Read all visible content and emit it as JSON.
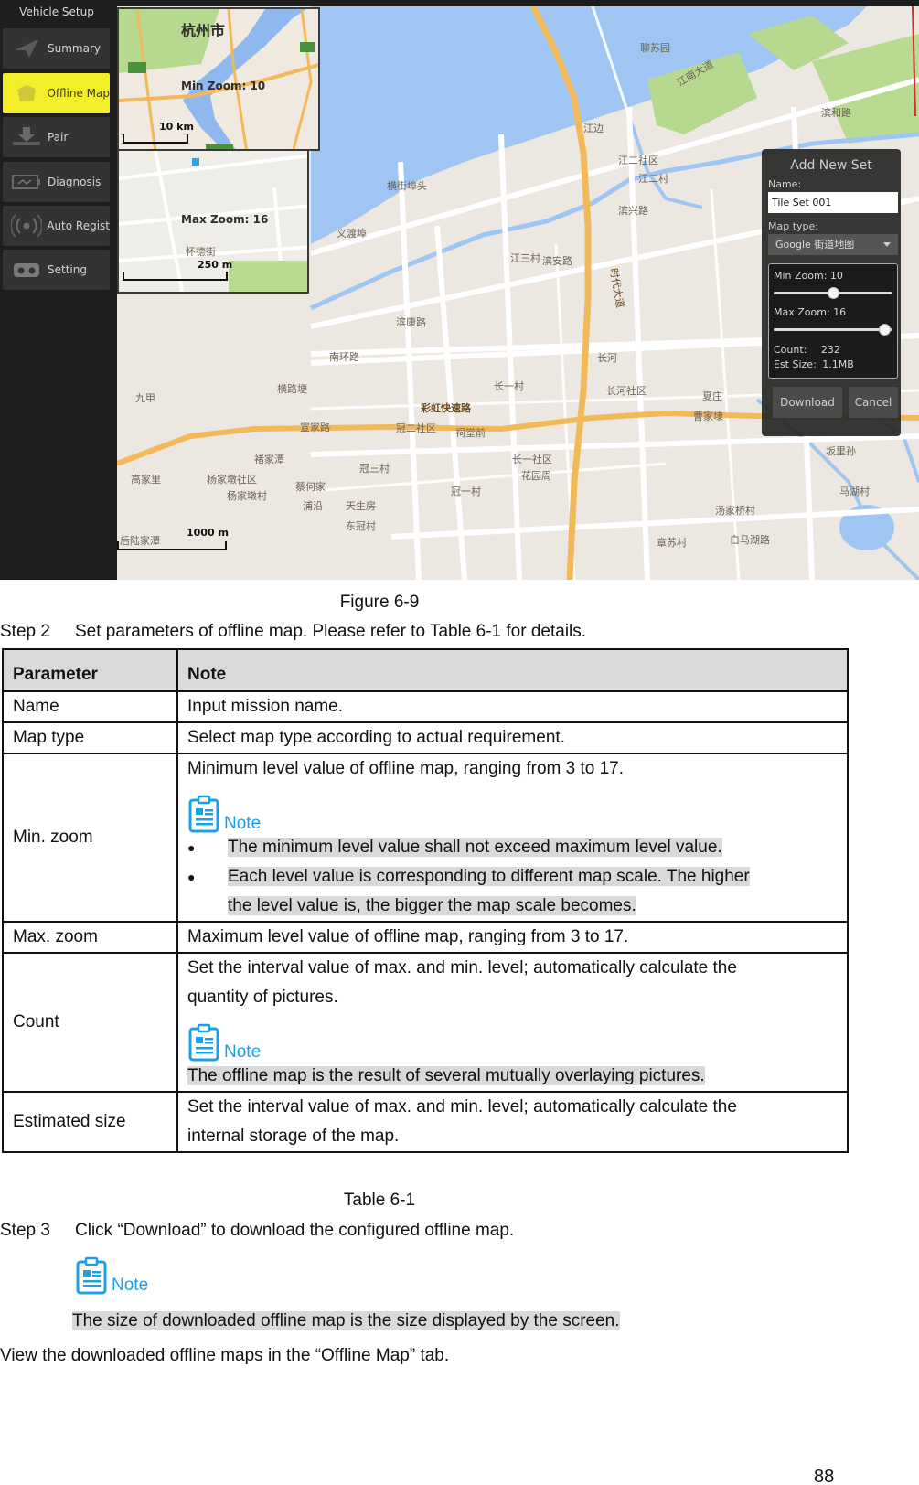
{
  "figure": {
    "sidebar": {
      "title": "Vehicle Setup",
      "items": [
        {
          "label": "Summary",
          "icon": "paper-plane-icon",
          "active": false
        },
        {
          "label": "Offline Map",
          "icon": "map-icon",
          "active": true
        },
        {
          "label": "Pair",
          "icon": "download-tray-icon",
          "active": false
        },
        {
          "label": "Diagnosis",
          "icon": "battery-pulse-icon",
          "active": false
        },
        {
          "label": "Auto Regist",
          "icon": "broadcast-icon",
          "active": false
        },
        {
          "label": "Setting",
          "icon": "controller-icon",
          "active": false
        }
      ]
    },
    "map": {
      "inset_min": {
        "label": "Min Zoom: 10",
        "scale": "10 km",
        "city": "杭州市"
      },
      "inset_max": {
        "label": "Max Zoom: 16",
        "scale": "250 m",
        "street": "怀德街"
      },
      "scale": "1000 m",
      "labels": [
        "江边",
        "江二社区",
        "江二村",
        "滨兴路",
        "江三村",
        "滨安路",
        "滨康路",
        "南环路",
        "长河",
        "长一村",
        "彩虹快速路",
        "冠二社区",
        "冠三村",
        "冠一村",
        "长一社区",
        "花园周",
        "杨家墩社区",
        "杨家墩村",
        "高家里",
        "蔡何家",
        "浦沿",
        "天生房",
        "东冠村",
        "长河社区",
        "夏庄",
        "曹家埭",
        "坂里孙",
        "马湖村",
        "汤家桥村",
        "章苏村",
        "白马湖路",
        "横街埠头",
        "义渡埠",
        "聊苏园",
        "时代大道",
        "江南大道",
        "滨和路",
        "九甲",
        "褚家潭",
        "祠堂前",
        "宣家路",
        "横路埂",
        "后陆家潭"
      ]
    },
    "dialog": {
      "title": "Add New Set",
      "name_label": "Name:",
      "name_value": "Tile Set 001",
      "map_type_label": "Map type:",
      "map_type_value": "Google 街道地图",
      "min_zoom_label": "Min Zoom: 10",
      "min_zoom": 10,
      "max_zoom_label": "Max Zoom: 16",
      "max_zoom": 16,
      "zoom_range": [
        3,
        17
      ],
      "count_label": "Count:",
      "count_value": "232",
      "size_label": "Est Size:",
      "size_value": "1.1MB",
      "download_button": "Download",
      "cancel_button": "Cancel"
    }
  },
  "figure_caption": "Figure 6-9",
  "step2": {
    "num": "Step 2",
    "text": "Set parameters of offline map. Please refer to Table 6-1 for details."
  },
  "table": {
    "headers": [
      "Parameter",
      "Note"
    ],
    "note_word": "Note",
    "rows": {
      "name": {
        "param": "Name",
        "note": "Input mission name."
      },
      "map_type": {
        "param": "Map type",
        "note": "Select map type according to actual requirement."
      },
      "min_zoom": {
        "param": "Min. zoom",
        "note": "Minimum level value of offline map, ranging from 3 to 17.",
        "bullets": [
          "The minimum level value shall not exceed maximum level value.",
          "Each level value is corresponding to different map scale. The higher",
          "the level value is, the bigger the map scale becomes."
        ]
      },
      "max_zoom": {
        "param": "Max. zoom",
        "note": "Maximum level value of offline map, ranging from 3 to 17."
      },
      "count": {
        "param": "Count",
        "note_line1": "Set the interval value of max. and min. level; automatically calculate the",
        "note_line2": "quantity of pictures.",
        "tip": "The offline map is the result of several mutually overlaying pictures."
      },
      "est_size": {
        "param": "Estimated size",
        "note_line1": "Set the interval value of max. and min. level; automatically calculate the",
        "note_line2": "internal storage of the map."
      }
    }
  },
  "table_caption": "Table 6-1",
  "step3": {
    "num": "Step 3",
    "text": "Click “Download” to download the configured offline map."
  },
  "step3_note": {
    "word": "Note",
    "text": "The size of downloaded offline map is the size displayed by the screen."
  },
  "closing": "View the downloaded offline maps in the “Offline Map” tab.",
  "page_number": "88",
  "colors": {
    "active_tab": "#f3ee2a",
    "note_blue": "#1aa0e8",
    "highlight": "#d9d9d9",
    "header_bg": "#d9d9d9"
  }
}
